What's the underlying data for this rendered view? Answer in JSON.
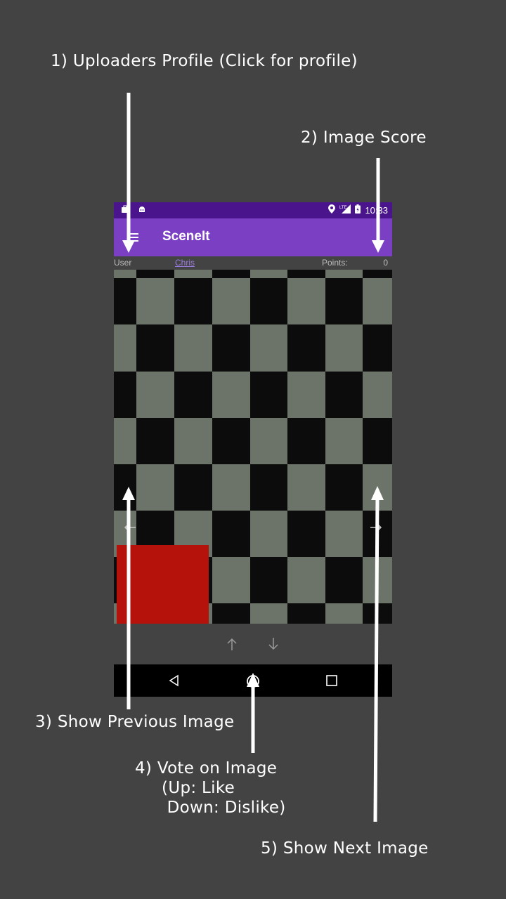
{
  "callouts": {
    "c1": "1) Uploaders Profile (Click for profile)",
    "c2": "2) Image Score",
    "c3": "3) Show Previous Image",
    "c4": "4) Vote on Image\n     (Up: Like\n      Down: Dislike)",
    "c5": "5) Show Next Image"
  },
  "status_bar": {
    "time": "10:33",
    "signal_label": "LTE",
    "icons": [
      "briefcase-icon",
      "android-icon",
      "location-icon",
      "signal-icon",
      "battery-icon"
    ]
  },
  "app_bar": {
    "title": "SceneIt",
    "menu_icon": "hamburger-menu-icon"
  },
  "info": {
    "user_label": "User",
    "user_name": "Chris",
    "points_label": "Points:",
    "points_value": "0"
  },
  "image": {
    "description_icon": "checkerboard-image",
    "prev_icon": "arrow-left-icon",
    "next_icon": "arrow-right-icon"
  },
  "vote": {
    "up_icon": "arrow-up-icon",
    "down_icon": "arrow-down-icon"
  },
  "nav_bar": {
    "icons": [
      "back-icon",
      "home-icon",
      "recents-icon"
    ]
  },
  "colors": {
    "background": "#434343",
    "status_bar": "#4a148c",
    "app_bar": "#7b3fc4",
    "link": "#9c7be0",
    "checker_light": "#6c7469",
    "checker_dark": "#0c0c0c",
    "red_block": "#b5120c"
  }
}
